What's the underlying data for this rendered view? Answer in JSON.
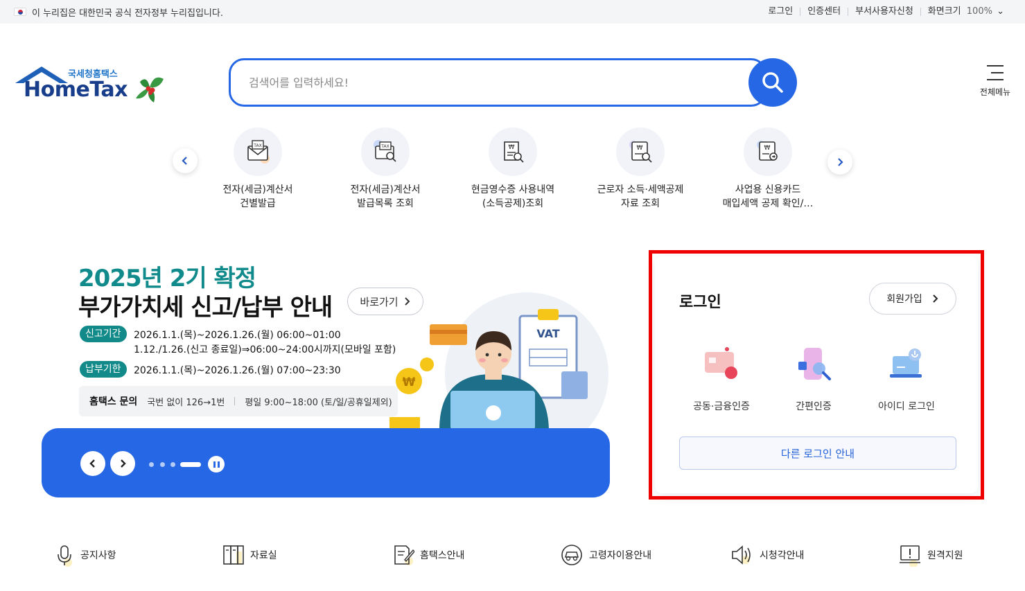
{
  "topbar": {
    "notice": "이 누리집은 대한민국 공식 전자정부 누리집입니다.",
    "links": [
      "로그인",
      "인증센터",
      "부서사용자신청"
    ],
    "zoom_label": "화면크기",
    "zoom_value": "100%"
  },
  "logo": {
    "ko": "국세청홈택스",
    "en": "HomeTax"
  },
  "search": {
    "placeholder": "검색어를 입력하세요!"
  },
  "allmenu": {
    "label": "전체메뉴"
  },
  "quick_items": [
    {
      "label": "전자(세금)계산서\n건별발급",
      "icon": "tax-invoice-envelope-icon"
    },
    {
      "label": "전자(세금)계산서\n발급목록 조회",
      "icon": "tax-invoice-search-icon"
    },
    {
      "label": "현금영수증 사용내역\n(소득공제)조회",
      "icon": "cash-receipt-search-icon"
    },
    {
      "label": "근로자 소득·세액공제\n자료 조회",
      "icon": "income-deduction-search-icon"
    },
    {
      "label": "사업용 신용카드\n매입세액 공제 확인/…",
      "icon": "business-card-icon"
    }
  ],
  "banner": {
    "title1": "2025년 2기 확정",
    "title2": "부가가치세 신고/납부 안내",
    "goto_label": "바로가기",
    "report_tag": "신고기간",
    "report_line1": "2026.1.1.(목)~2026.1.26.(월) 06:00~01:00",
    "report_line2": "1.12./1.26.(신고 종료일)⇒06:00~24:00시까지(모바일 포함)",
    "pay_tag": "납부기한",
    "pay_line": "2026.1.1.(목)~2026.1.26.(월) 07:00~23:30",
    "inquiry_label": "홈택스 문의",
    "inquiry_phone": "국번 없이 126→1번",
    "inquiry_hours": "평일 9:00~18:00 (토/일/공휴일제외)",
    "illus_text": "VAT",
    "slide_count": 4,
    "active_slide": 4
  },
  "login": {
    "title": "로그인",
    "join_label": "회원가입",
    "options": [
      "공동·금융인증",
      "간편인증",
      "아이디 로그인"
    ],
    "other_label": "다른 로그인 안내"
  },
  "bottom_menu": [
    {
      "label": "공지사항",
      "icon": "microphone-icon"
    },
    {
      "label": "자료실",
      "icon": "archive-icon"
    },
    {
      "label": "홈택스안내",
      "icon": "document-edit-icon"
    },
    {
      "label": "고령자이용안내",
      "icon": "elderly-car-icon"
    },
    {
      "label": "시청각안내",
      "icon": "speaker-icon"
    },
    {
      "label": "원격지원",
      "icon": "remote-monitor-icon"
    }
  ],
  "colors": {
    "accent": "#2567e4",
    "teal": "#128a8a",
    "highlight": "#ee0000"
  }
}
